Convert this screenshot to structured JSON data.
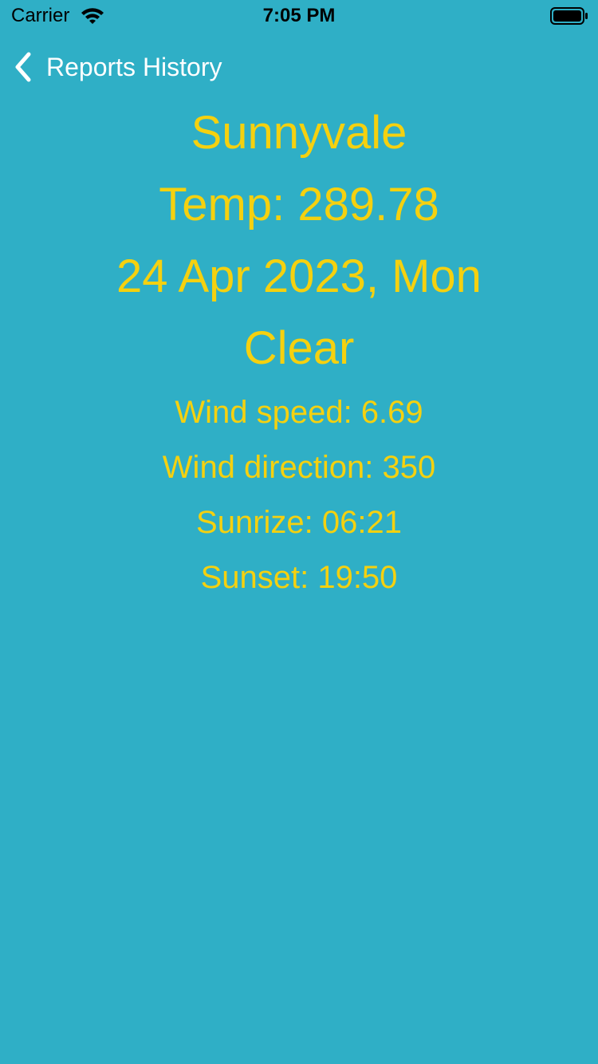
{
  "status_bar": {
    "carrier": "Carrier",
    "time": "7:05 PM"
  },
  "nav": {
    "back_label": "Reports History"
  },
  "report": {
    "city": "Sunnyvale",
    "temp": "Temp: 289.78",
    "date": "24 Apr 2023, Mon",
    "condition": "Clear",
    "wind_speed": "Wind speed: 6.69",
    "wind_direction": "Wind direction: 350",
    "sunrise": "Sunrize: 06:21",
    "sunset": "Sunset: 19:50"
  },
  "colors": {
    "background": "#2FAFC6",
    "text": "#F5D10F",
    "nav_text": "#FFFFFF"
  }
}
